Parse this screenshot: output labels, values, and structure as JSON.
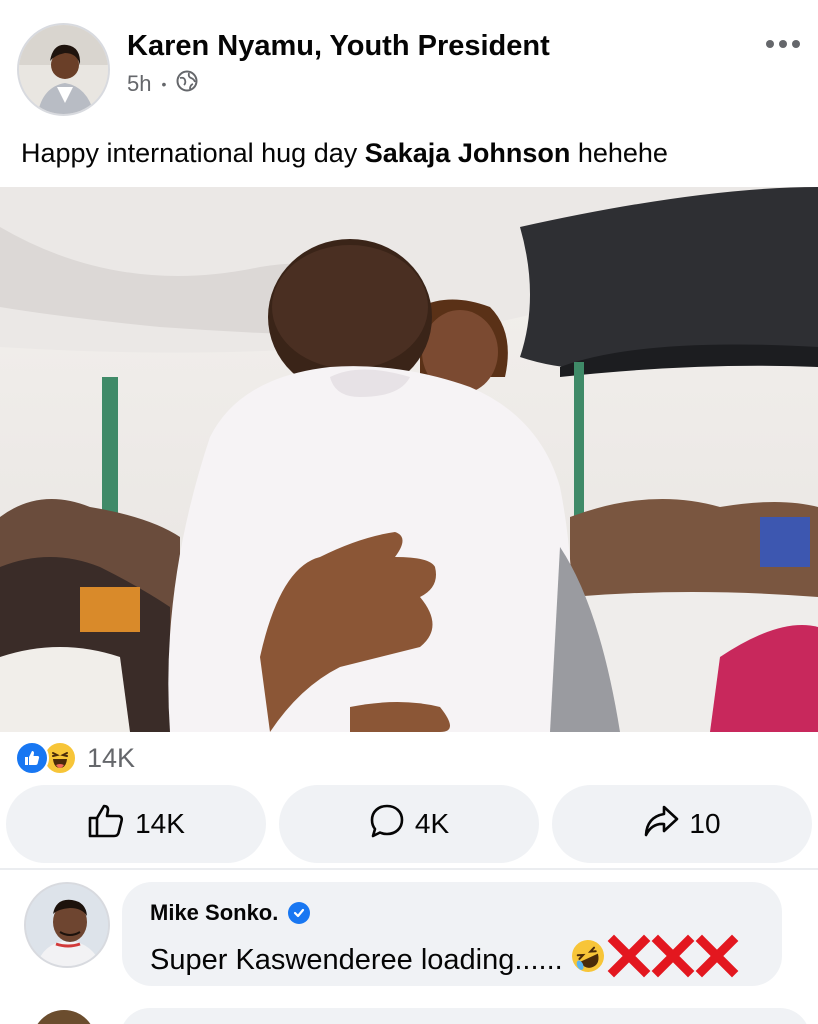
{
  "post": {
    "author": "Karen Nyamu, Youth President",
    "time": "5h",
    "separator": "•",
    "text_before": "Happy international hug day ",
    "text_bold": "Sakaja Johnson",
    "text_after": " hehehe"
  },
  "icons": {
    "more": "more-options-icon",
    "privacy": "globe-icon",
    "like_reaction": "like-reaction-icon",
    "haha_reaction": "haha-reaction-icon",
    "like_button": "thumbs-up-icon",
    "comment_button": "comment-icon",
    "share_button": "share-icon",
    "verified": "verified-badge-icon"
  },
  "reactions": {
    "count": "14K"
  },
  "actions": {
    "like_count": "14K",
    "comment_count": "4K",
    "share_count": "10"
  },
  "comment": {
    "author": "Mike Sonko.",
    "text": "Super Kaswenderee loading......"
  },
  "colors": {
    "facebook_blue": "#1877f2",
    "button_bg": "#f0f2f5",
    "secondary_text": "#65676b",
    "cross_red": "#e3171f"
  }
}
